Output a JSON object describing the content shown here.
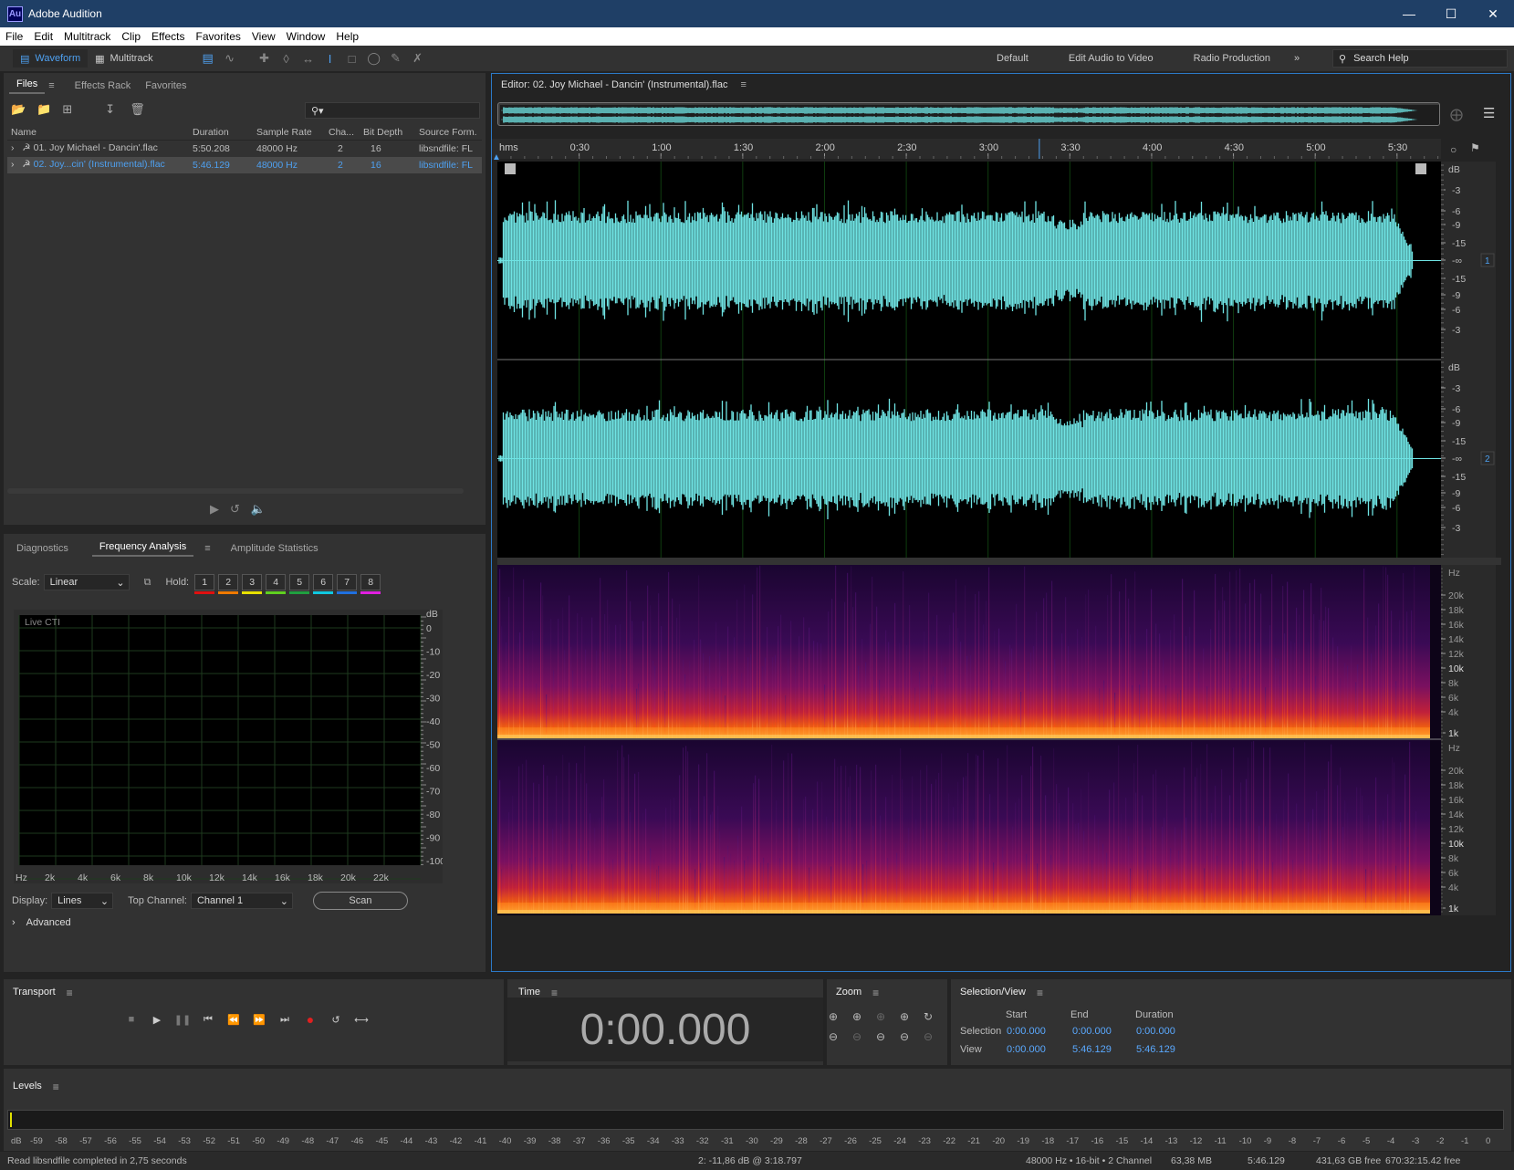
{
  "app": {
    "title": "Adobe Audition",
    "logo": "Au"
  },
  "menu": [
    "File",
    "Edit",
    "Multitrack",
    "Clip",
    "Effects",
    "Favorites",
    "View",
    "Window",
    "Help"
  ],
  "toolbar": {
    "waveform_label": "Waveform",
    "multitrack_label": "Multitrack"
  },
  "workspaces": [
    "Default",
    "Edit Audio to Video",
    "Radio Production"
  ],
  "search_help": {
    "placeholder": "Search Help"
  },
  "files_panel": {
    "tabs": [
      "Files",
      "Effects Rack",
      "Favorites"
    ],
    "columns": [
      "Name",
      "Duration",
      "Sample Rate",
      "Cha...",
      "Bit Depth",
      "Source Form..."
    ],
    "rows": [
      {
        "name": "01. Joy Michael - Dancin'.flac",
        "duration": "5:50.208",
        "rate": "48000 Hz",
        "ch": "2",
        "bits": "16",
        "source": "libsndfile: FL"
      },
      {
        "name": "02. Joy...cin' (Instrumental).flac",
        "duration": "5:46.129",
        "rate": "48000 Hz",
        "ch": "2",
        "bits": "16",
        "source": "libsndfile: FL"
      }
    ]
  },
  "analysis_panel": {
    "tabs": [
      "Diagnostics",
      "Frequency Analysis",
      "Amplitude Statistics"
    ],
    "scale_label": "Scale:",
    "scale_value": "Linear",
    "hold_label": "Hold:",
    "hold": [
      {
        "n": "1",
        "color": "#e01010"
      },
      {
        "n": "2",
        "color": "#f07a00"
      },
      {
        "n": "3",
        "color": "#e8e000"
      },
      {
        "n": "4",
        "color": "#60d020"
      },
      {
        "n": "5",
        "color": "#20a040"
      },
      {
        "n": "6",
        "color": "#10c8e0"
      },
      {
        "n": "7",
        "color": "#2070e0"
      },
      {
        "n": "8",
        "color": "#e020e0"
      }
    ],
    "graph_label": "Live CTI",
    "db_ticks": [
      "dB",
      "0",
      "-10",
      "-20",
      "-30",
      "-40",
      "-50",
      "-60",
      "-70",
      "-80",
      "-90",
      "-100"
    ],
    "hz_ticks": [
      "Hz",
      "2k",
      "4k",
      "6k",
      "8k",
      "10k",
      "12k",
      "14k",
      "16k",
      "18k",
      "20k",
      "22k"
    ],
    "display_label": "Display:",
    "display_value": "Lines",
    "top_channel_label": "Top Channel:",
    "top_channel_value": "Channel 1",
    "scan_label": "Scan",
    "advanced_label": "Advanced"
  },
  "editor": {
    "title": "Editor: 02. Joy Michael - Dancin' (Instrumental).flac",
    "timeline": [
      "hms",
      "0:30",
      "1:00",
      "1:30",
      "2:00",
      "2:30",
      "3:00",
      "3:30",
      "4:00",
      "4:30",
      "5:00",
      "5:30"
    ],
    "db_ruler": [
      "dB",
      "-3",
      "-6",
      "-9",
      "-15",
      "-∞",
      "-15",
      "-9",
      "-6",
      "-3"
    ],
    "channels": [
      "1",
      "2"
    ],
    "hz_ruler": [
      "Hz",
      "20k",
      "18k",
      "16k",
      "14k",
      "12k",
      "10k",
      "8k",
      "6k",
      "4k",
      "1k"
    ],
    "waveform_color": "#6fe3e3"
  },
  "transport": {
    "title": "Transport"
  },
  "time": {
    "title": "Time",
    "value": "0:00.000"
  },
  "zoom": {
    "title": "Zoom"
  },
  "selection_view": {
    "title": "Selection/View",
    "headers": [
      "Start",
      "End",
      "Duration"
    ],
    "selection_label": "Selection",
    "view_label": "View",
    "selection": [
      "0:00.000",
      "0:00.000",
      "0:00.000"
    ],
    "view": [
      "0:00.000",
      "5:46.129",
      "5:46.129"
    ]
  },
  "levels": {
    "title": "Levels",
    "scale": [
      "dB",
      "-59",
      "-58",
      "-57",
      "-56",
      "-55",
      "-54",
      "-53",
      "-52",
      "-51",
      "-50",
      "-49",
      "-48",
      "-47",
      "-46",
      "-45",
      "-44",
      "-43",
      "-42",
      "-41",
      "-40",
      "-39",
      "-38",
      "-37",
      "-36",
      "-35",
      "-34",
      "-33",
      "-32",
      "-31",
      "-30",
      "-29",
      "-28",
      "-27",
      "-26",
      "-25",
      "-24",
      "-23",
      "-22",
      "-21",
      "-20",
      "-19",
      "-18",
      "-17",
      "-16",
      "-15",
      "-14",
      "-13",
      "-12",
      "-11",
      "-10",
      "-9",
      "-8",
      "-7",
      "-6",
      "-5",
      "-4",
      "-3",
      "-2",
      "-1",
      "0"
    ]
  },
  "status": {
    "message": "Read libsndfile completed in 2,75 seconds",
    "cursor": "2: -11,86 dB @ 3:18.797",
    "format": "48000 Hz • 16-bit • 2 Channel",
    "size": "63,38 MB",
    "duration": "5:46.129",
    "free": "431,63 GB free",
    "free_time": "670:32:15.42 free"
  }
}
